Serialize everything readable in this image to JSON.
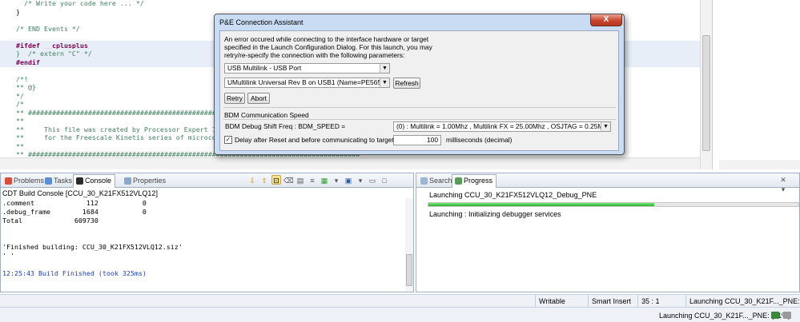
{
  "editor": {
    "lines": [
      {
        "text": "  /* Write your code here ... */",
        "style": "cm",
        "hl": false
      },
      {
        "text": "}",
        "style": "",
        "hl": false
      },
      {
        "text": "",
        "style": "",
        "hl": false
      },
      {
        "text": "/* END Events */",
        "style": "cm",
        "hl": false
      },
      {
        "text": "",
        "style": "",
        "hl": false
      },
      {
        "text": "#ifdef __cplusplus",
        "style": "kw",
        "hl": true
      },
      {
        "text": "}  /* extern \"C\" */",
        "style": "cm",
        "hl": true
      },
      {
        "text": "#endif",
        "style": "kw",
        "hl": true
      },
      {
        "text": "",
        "style": "",
        "hl": false
      },
      {
        "text": "/*!",
        "style": "cm",
        "hl": false
      },
      {
        "text": "** @}",
        "style": "cm",
        "hl": false
      },
      {
        "text": "*/",
        "style": "cm",
        "hl": false
      },
      {
        "text": "/*",
        "style": "cm",
        "hl": false
      },
      {
        "text": "** ###################################################################################",
        "style": "cm",
        "hl": false
      },
      {
        "text": "**",
        "style": "cm",
        "hl": false
      },
      {
        "text": "**     This file was created by Processor Expert 10.5 [",
        "style": "cm",
        "hl": false
      },
      {
        "text": "**     for the Freescale Kinetis series of microcontrol",
        "style": "cm",
        "hl": false
      },
      {
        "text": "**",
        "style": "cm",
        "hl": false
      },
      {
        "text": "** ###################################################################################",
        "style": "cm",
        "hl": false
      },
      {
        "text": "*/",
        "style": "cm",
        "hl": false
      }
    ]
  },
  "console_pane": {
    "tabs": [
      {
        "label": "Problems",
        "active": false
      },
      {
        "label": "Tasks",
        "active": false
      },
      {
        "label": "Console",
        "active": true
      },
      {
        "label": "Properties",
        "active": false
      }
    ],
    "title": "CDT Build Console [CCU_30_K21FX512VLQ12]",
    "lines": [
      {
        "text": ".comment             112           0",
        "color": "#000000"
      },
      {
        "text": ".debug_frame        1684           0",
        "color": "#000000"
      },
      {
        "text": "Total             609730",
        "color": "#000000"
      },
      {
        "text": "",
        "color": "#000000"
      },
      {
        "text": "",
        "color": "#000000"
      },
      {
        "text": "'Finished building: CCU_30_K21FX512VLQ12.siz'",
        "color": "#000000"
      },
      {
        "text": "' '",
        "color": "#000000"
      },
      {
        "text": "",
        "color": "#000000"
      },
      {
        "text": "12:25:43 Build Finished (took 325ms)",
        "color": "#1a3fb0"
      }
    ]
  },
  "progress_pane": {
    "tabs": [
      {
        "label": "Search",
        "active": false
      },
      {
        "label": "Progress",
        "active": true
      }
    ],
    "job_title": "Launching CCU_30_K21FX512VLQ12_Debug_PNE",
    "progress": 0.61,
    "status": "Launching : Initializing debugger services"
  },
  "statusbar": {
    "writable": "Writable",
    "insert_mode": "Smart Insert",
    "position": "35 : 1",
    "job": "Launching CCU_30_K21F..._PNE: (61%)"
  },
  "taskbar": {
    "job": "Launching CCU_30_K21F..._PNE: (61%)"
  },
  "dialog": {
    "title": "P&E Connection Assistant",
    "close_label": "X",
    "message": "An error occured while connecting to the interface hardware or target specified in the Launch Configuration Dialog. For this launch, you may retry/re-specify the connection with the following parameters:",
    "interface_combo": "USB Multilink - USB Port",
    "port_combo": "UMultilink Universal Rev B on USB1 (Name=PE5655975) (A",
    "refresh_label": "Refresh",
    "retry_label": "Retry",
    "abort_label": "Abort",
    "bdm_section": "BDM Communication Speed",
    "bdm_label": "BDM Debug Shift Freq : BDM_SPEED =",
    "bdm_combo": "(0) :  Multilink = 1.00Mhz ,  Multilink FX = 25.00Mhz ,  OSJTAG = 0.25Mhz",
    "delay_label": "Delay after Reset and before communicating to target for",
    "delay_value": "100",
    "delay_unit": "milliseconds (decimal)",
    "delay_checked": true
  }
}
